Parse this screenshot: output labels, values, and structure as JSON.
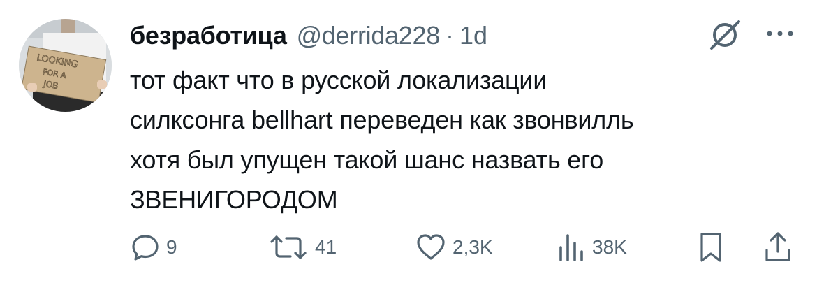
{
  "tweet": {
    "author": {
      "display_name": "безработица",
      "handle": "@derrida228",
      "avatar_sign": [
        "LOOKING",
        "FOR A",
        "JOB"
      ]
    },
    "separator": "·",
    "time": "1d",
    "text_lines": [
      "тот факт что в русской локализации",
      "силксонга bellhart переведен как звонвилль",
      "хотя был упущен такой шанс назвать его",
      "ЗВЕНИГОРОДОМ"
    ],
    "actions": {
      "replies": "9",
      "retweets": "41",
      "likes": "2,3K",
      "views": "38K"
    },
    "icons": [
      "grok-icon",
      "more-icon",
      "reply-icon",
      "retweet-icon",
      "like-icon",
      "views-icon",
      "bookmark-icon",
      "share-icon"
    ],
    "colors": {
      "text": "#0f1419",
      "secondary": "#536471"
    }
  }
}
